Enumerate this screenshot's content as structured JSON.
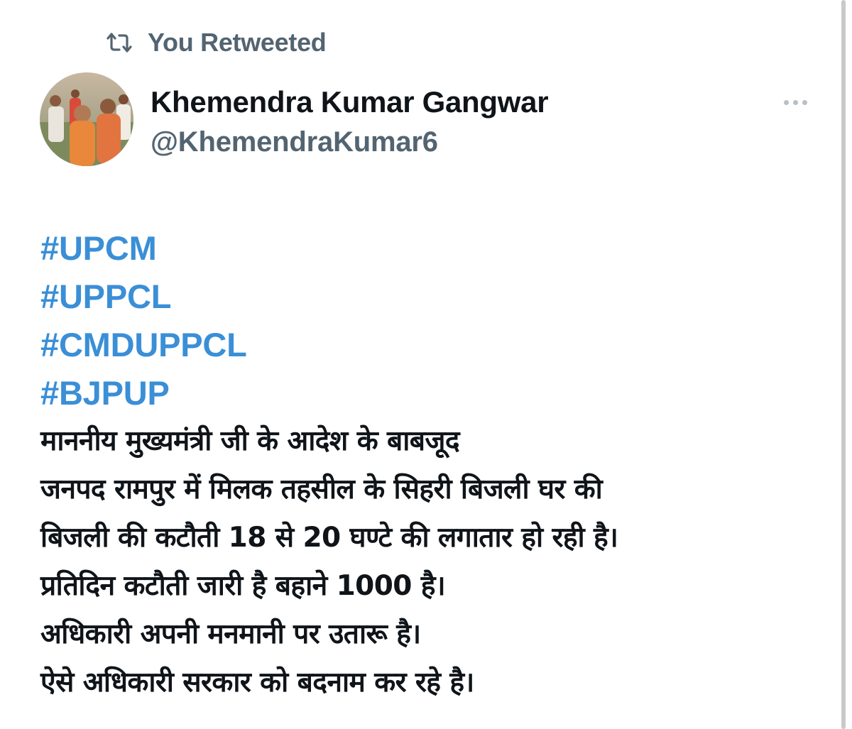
{
  "retweet_banner": {
    "icon": "retweet-icon",
    "label": "You Retweeted"
  },
  "author": {
    "avatar_icon": "profile-photo",
    "display_name": "Khemendra Kumar Gangwar",
    "handle": "@KhemendraKumar6"
  },
  "more_menu": {
    "icon": "more-options-icon"
  },
  "tweet": {
    "hashtags": [
      "#UPCM",
      "#UPPCL",
      "#CMDUPPCL",
      "#BJPUP"
    ],
    "lines": [
      "माननीय मुख्यमंत्री जी के आदेश के बाबजूद",
      "जनपद रामपुर में मिलक तहसील के सिहरी बिजली घर की",
      "बिजली की कटौती 18 से 20 घण्टे की लगातार हो रही है।",
      "प्रतिदिन कटौती जारी है बहाने 1000 है।",
      "अधिकारी अपनी मनमानी पर उतारू है।",
      "ऐसे अधिकारी सरकार को बदनाम कर रहे है।"
    ]
  },
  "colors": {
    "hashtag": "#3a8fd6",
    "secondary_text": "#536471",
    "primary_text": "#0f1419"
  }
}
